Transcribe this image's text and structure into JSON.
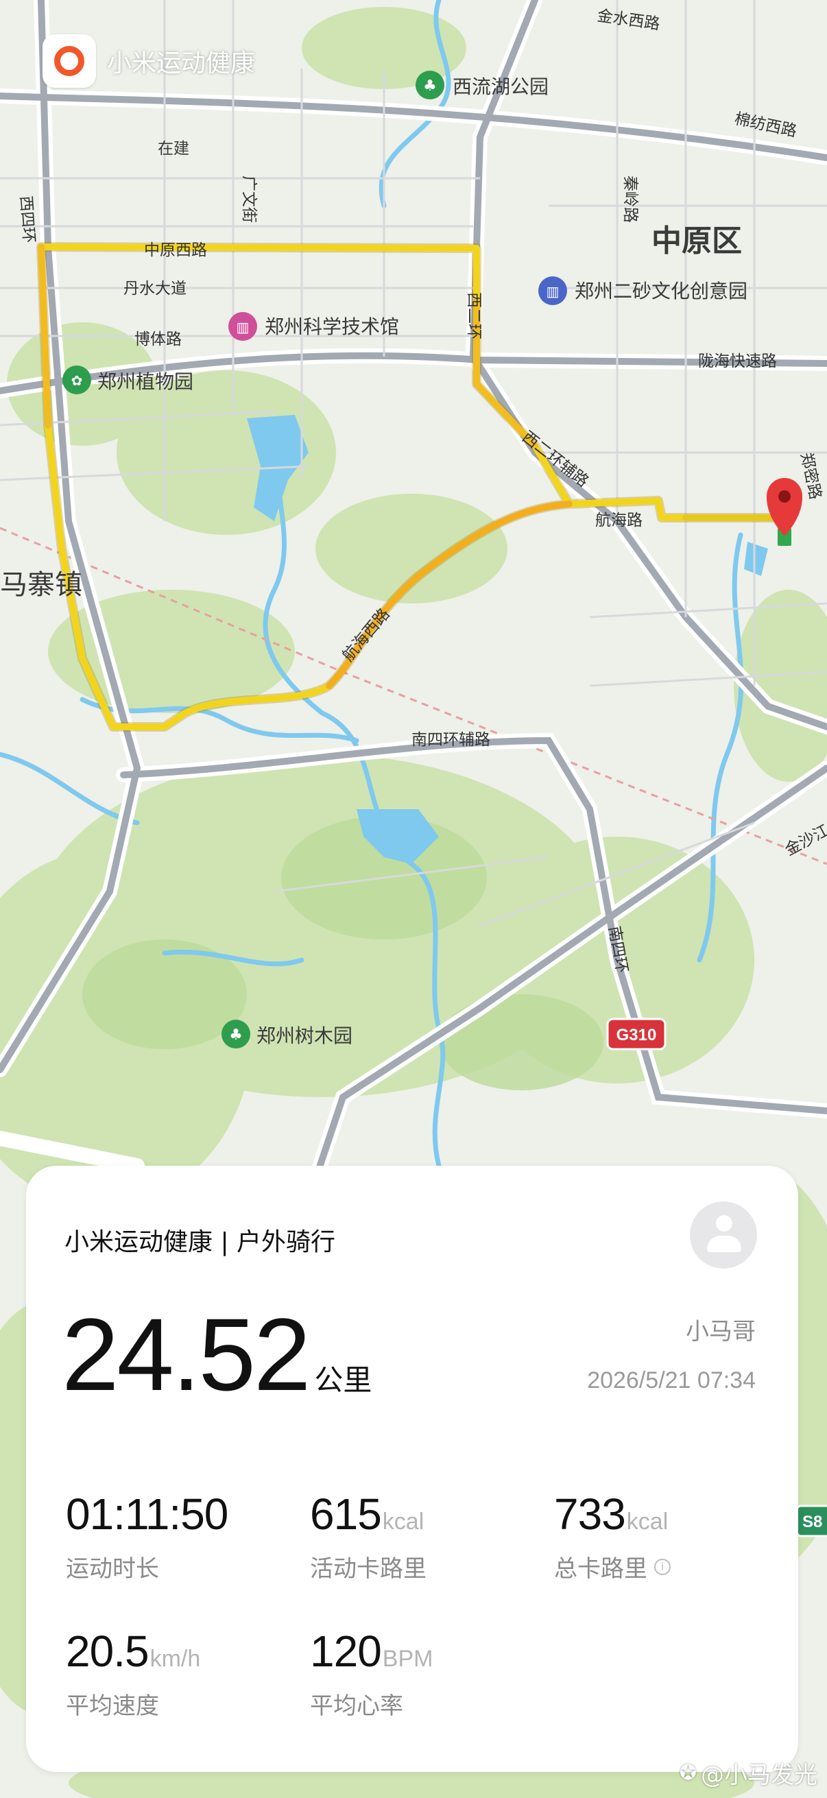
{
  "app_badge": {
    "name": "小米运动健康",
    "icon": "xiaomi-health-ring-icon"
  },
  "map": {
    "labels": {
      "place_1": "西流湖公园",
      "district": "中原区",
      "place_2": "郑州二砂文化创意园",
      "place_3": "郑州科学技术馆",
      "place_4": "郑州植物园",
      "town": "马寨镇",
      "place_5": "郑州树木园",
      "misc_1": "在建"
    },
    "roads": {
      "r1": "金水西路",
      "r2": "棉纺西路",
      "r3": "秦岭路",
      "r4": "中原西路",
      "r5": "丹水大道",
      "r6": "博体路",
      "r7": "陇海快速路",
      "r8": "西二环",
      "r9": "西二环辅路",
      "r10": "航海路",
      "r11": "航海西路",
      "r12": "南四环辅路",
      "r13": "南四环",
      "r14": "金沙江",
      "r15": "郑密路",
      "r16": "西四环",
      "r17": "广文街"
    },
    "badges": {
      "highway": "G310",
      "expressway": "S8"
    },
    "colors": {
      "route": "#f1d21c",
      "route_hot": "#f09a1a",
      "water": "#7ec8ee",
      "green": "#cde3b0",
      "road": "#9aa0a8",
      "pin": "#e63a3a"
    }
  },
  "card": {
    "title": "小米运动健康 | 户外骑行",
    "user": "小马哥",
    "datetime": "2026/5/21 07:34",
    "distance": {
      "value": "24.52",
      "unit": "公里"
    },
    "stats": [
      {
        "value": "01:11:50",
        "unit": "",
        "label": "运动时长"
      },
      {
        "value": "615",
        "unit": "kcal",
        "label": "活动卡路里"
      },
      {
        "value": "733",
        "unit": "kcal",
        "label": "总卡路里"
      },
      {
        "value": "20.5",
        "unit": "km/h",
        "label": "平均速度"
      },
      {
        "value": "120",
        "unit": "BPM",
        "label": "平均心率"
      }
    ]
  },
  "watermark": "@小马发光"
}
